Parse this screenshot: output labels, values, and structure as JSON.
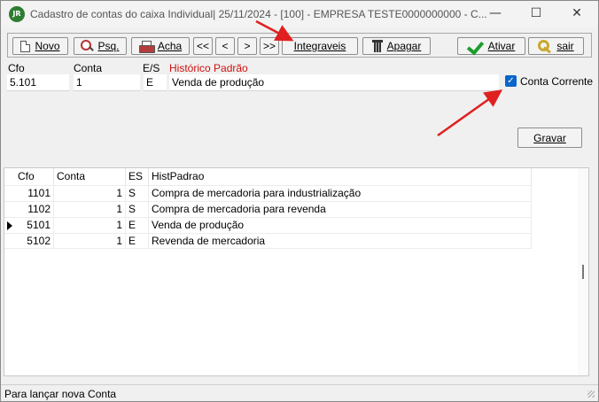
{
  "window": {
    "app_icon_text": "JR",
    "title": "Cadastro de contas do caixa Individual|  25/11/2024 - [100] - EMPRESA TESTE0000000000 - C...",
    "controls": {
      "minimize": "—",
      "maximize": "☐",
      "close": "✕"
    }
  },
  "toolbar": {
    "novo": "Novo",
    "psq": "Psq.",
    "acha": "Acha",
    "first": "<<",
    "prev": "<",
    "next": ">",
    "last": ">>",
    "integraveis": "Integraveis",
    "apagar": "Apagar",
    "ativar": "Ativar",
    "sair": "sair"
  },
  "form": {
    "cfo_label": "Cfo",
    "conta_label": "Conta",
    "es_label": "E/S",
    "historico_label": "Histórico Padrão",
    "cfo_value": "5.101",
    "conta_value": "1",
    "es_value": "E",
    "historico_value": "Venda de produção",
    "conta_corrente_label": "Conta Corrente",
    "conta_corrente_checked": true,
    "check_mark": "✓",
    "gravar": "Gravar"
  },
  "grid": {
    "columns": [
      "Cfo",
      "Conta",
      "ES",
      "HistPadrao"
    ],
    "rows": [
      {
        "cfo": "1101",
        "conta": "1",
        "es": "S",
        "hist": "Compra de mercadoria para industrialização",
        "current": false
      },
      {
        "cfo": "1102",
        "conta": "1",
        "es": "S",
        "hist": "Compra de mercadoria para revenda",
        "current": false
      },
      {
        "cfo": "5101",
        "conta": "1",
        "es": "E",
        "hist": "Venda de produção",
        "current": true
      },
      {
        "cfo": "5102",
        "conta": "1",
        "es": "E",
        "hist": "Revenda de mercadoria",
        "current": false
      }
    ]
  },
  "status": {
    "text": "Para lançar nova Conta"
  },
  "colors": {
    "annotation_arrow": "#e02020",
    "label_red": "#d01010",
    "checkbox_blue": "#0a66c8",
    "ativar_check": "#1e9e2c"
  }
}
